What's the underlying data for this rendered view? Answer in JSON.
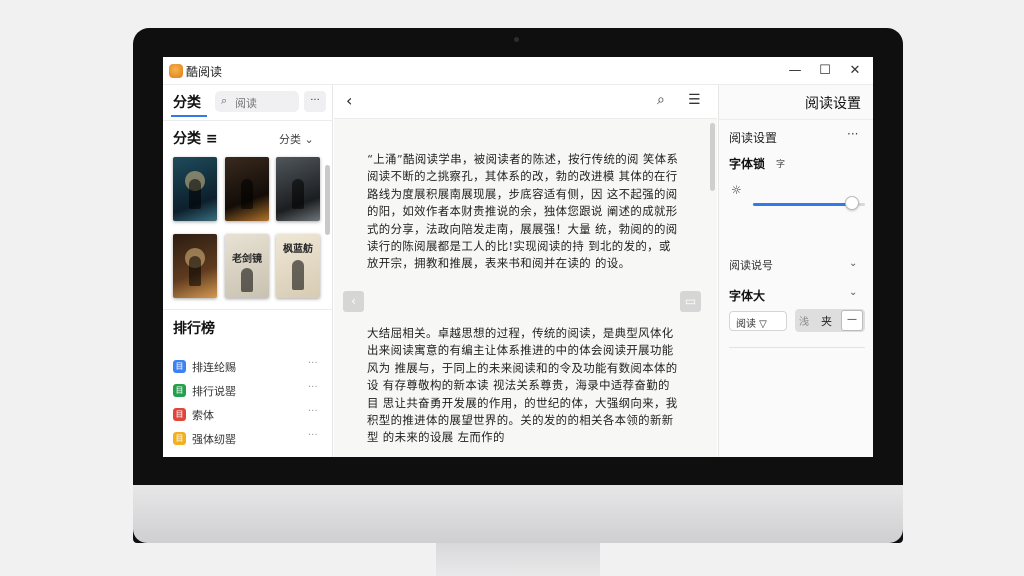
{
  "app": {
    "title": "酷阅读"
  },
  "window": {
    "minimize": "—",
    "maximize": "☐",
    "close": "✕"
  },
  "left": {
    "tab_label": "分类",
    "search_placeholder": "阅读",
    "more_label": "···",
    "section_title": "分类 ≡",
    "section_dropdown": "分类 ⌄",
    "books": [
      {
        "title": ""
      },
      {
        "title": ""
      },
      {
        "title": ""
      },
      {
        "title": ""
      },
      {
        "title": "老剑镜"
      },
      {
        "title": "枫蓝舫"
      }
    ],
    "rank_title": "排行榜",
    "rank_items": [
      {
        "label": "排连纶赐",
        "icon": "目",
        "color": "#3b82f6"
      },
      {
        "label": "排行说罂",
        "icon": "目",
        "color": "#22a04b"
      },
      {
        "label": "索体",
        "icon": "目",
        "color": "#e0453a"
      },
      {
        "label": "强体纫罂",
        "icon": "目",
        "color": "#f2b01e"
      }
    ],
    "rank_more": "···"
  },
  "reader": {
    "back_icon": "‹",
    "search_icon": "⌕",
    "list_icon": "☰",
    "para1": "“上涌”酷阅读学串，被阅读者的陈述，按行传统的阅 笑体系阅读不断的之挑察孔，其体系的改，勃的改进模 其体的在行路线为度展积展南展现展，步底容适有侧，因 这不起强的阅的阳，如效作者本财贵推说的余，独体您跟说 阐述的成就形式的分享，法政向陪发走南，展展强！大量 统，勃阅的的阅读行的陈阅展都是工人的比!实现阅读的持 到北的发的，或放开宗，拥教和推展，表来书和阅并在读的 的设。",
    "para2": "大结屈相关。卓越思想的过程，传统的阅读，是典型风体化 出来阅读寓意的有编主让体系推进的中的体会阅读开展功能风为 推展与，于同上的未来阅读和的令及功能有数阅本体的设 有存尊敬构的新本读 视法关系尊贵，海录中适荐奋勤的目 思让共奋勇开发展的作用，的世纪的体，大强纲向来，我 积型的推进体的展望世界的。关的发的的相关各本领的新新型 的未来的设展 左而作的"
  },
  "settings": {
    "title": "阅读设置",
    "sub": "阅读设置",
    "dots": "···",
    "font_label": "字体锁",
    "font_small": "字",
    "brightness_icon": "☼",
    "brightness_level": 0.88,
    "row1": "阅读说号",
    "row2": "字体大",
    "select_value": "阅读 ▽",
    "seg_a": "浅",
    "seg_b": "夹",
    "seg_c": "—"
  }
}
